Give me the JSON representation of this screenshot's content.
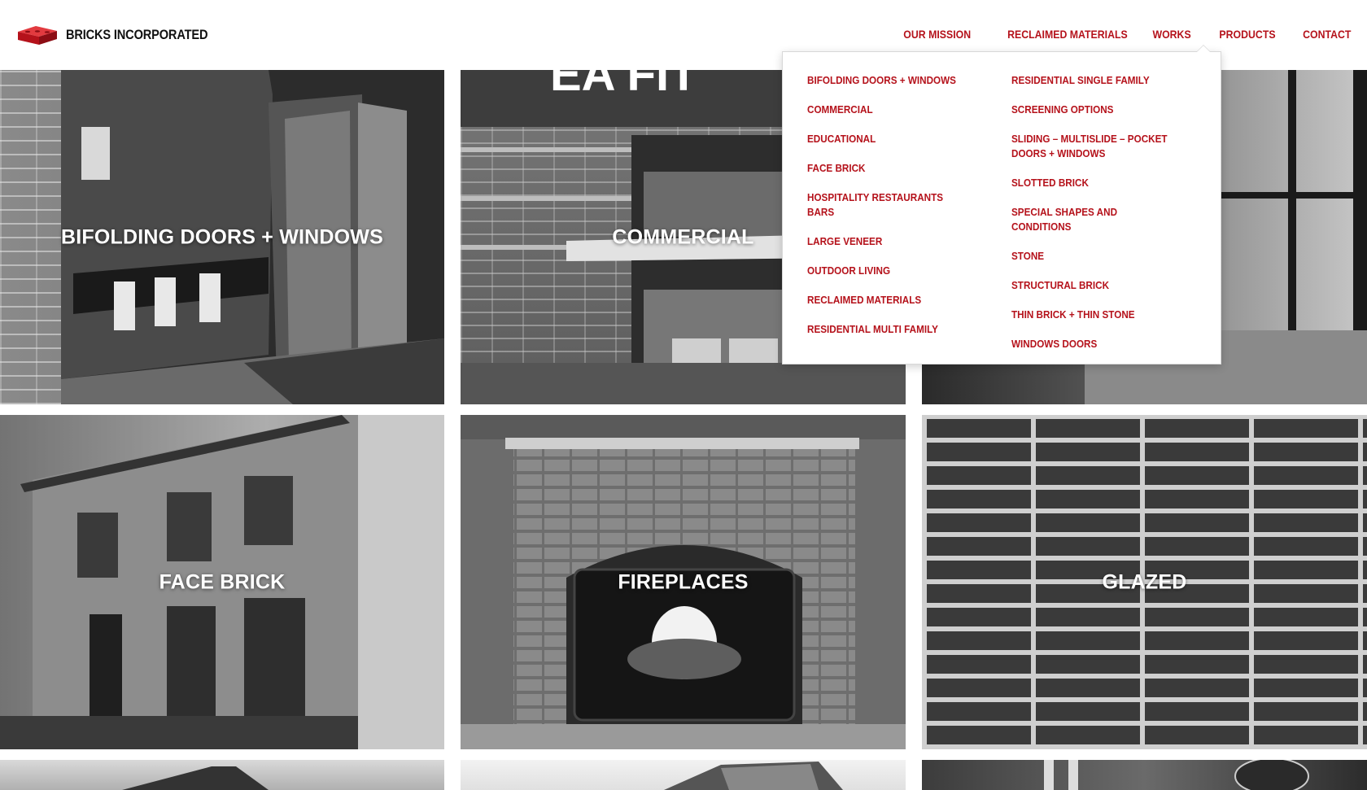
{
  "brand": {
    "name": "BRICKS INCORPORATED",
    "logo_icon": "brick-logo-icon",
    "accent": "#b5121b"
  },
  "nav": {
    "items": [
      {
        "label": "OUR MISSION"
      },
      {
        "label": "RECLAIMED MATERIALS"
      },
      {
        "label": "WORKS"
      },
      {
        "label": "PRODUCTS"
      },
      {
        "label": "CONTACT"
      }
    ]
  },
  "dropdown": {
    "col1": [
      "BIFOLDING DOORS + WINDOWS",
      "COMMERCIAL",
      "EDUCATIONAL",
      "FACE BRICK",
      "HOSPITALITY RESTAURANTS BARS",
      "LARGE VENEER",
      "OUTDOOR LIVING",
      "RECLAIMED MATERIALS",
      "RESIDENTIAL MULTI FAMILY"
    ],
    "col2": [
      "RESIDENTIAL SINGLE FAMILY",
      "SCREENING OPTIONS",
      "SLIDING – MULTISLIDE – POCKET DOORS + WINDOWS",
      "SLOTTED BRICK",
      "SPECIAL SHAPES AND CONDITIONS",
      "STONE",
      "STRUCTURAL BRICK",
      "THIN BRICK + THIN STONE",
      "WINDOWS DOORS"
    ]
  },
  "tiles": [
    {
      "title": "BIFOLDING DOORS + WINDOWS"
    },
    {
      "title": "COMMERCIAL"
    },
    {
      "title": ""
    },
    {
      "title": "FACE BRICK"
    },
    {
      "title": "FIREPLACES"
    },
    {
      "title": "GLAZED"
    },
    {
      "title": ""
    },
    {
      "title": ""
    },
    {
      "title": ""
    }
  ]
}
